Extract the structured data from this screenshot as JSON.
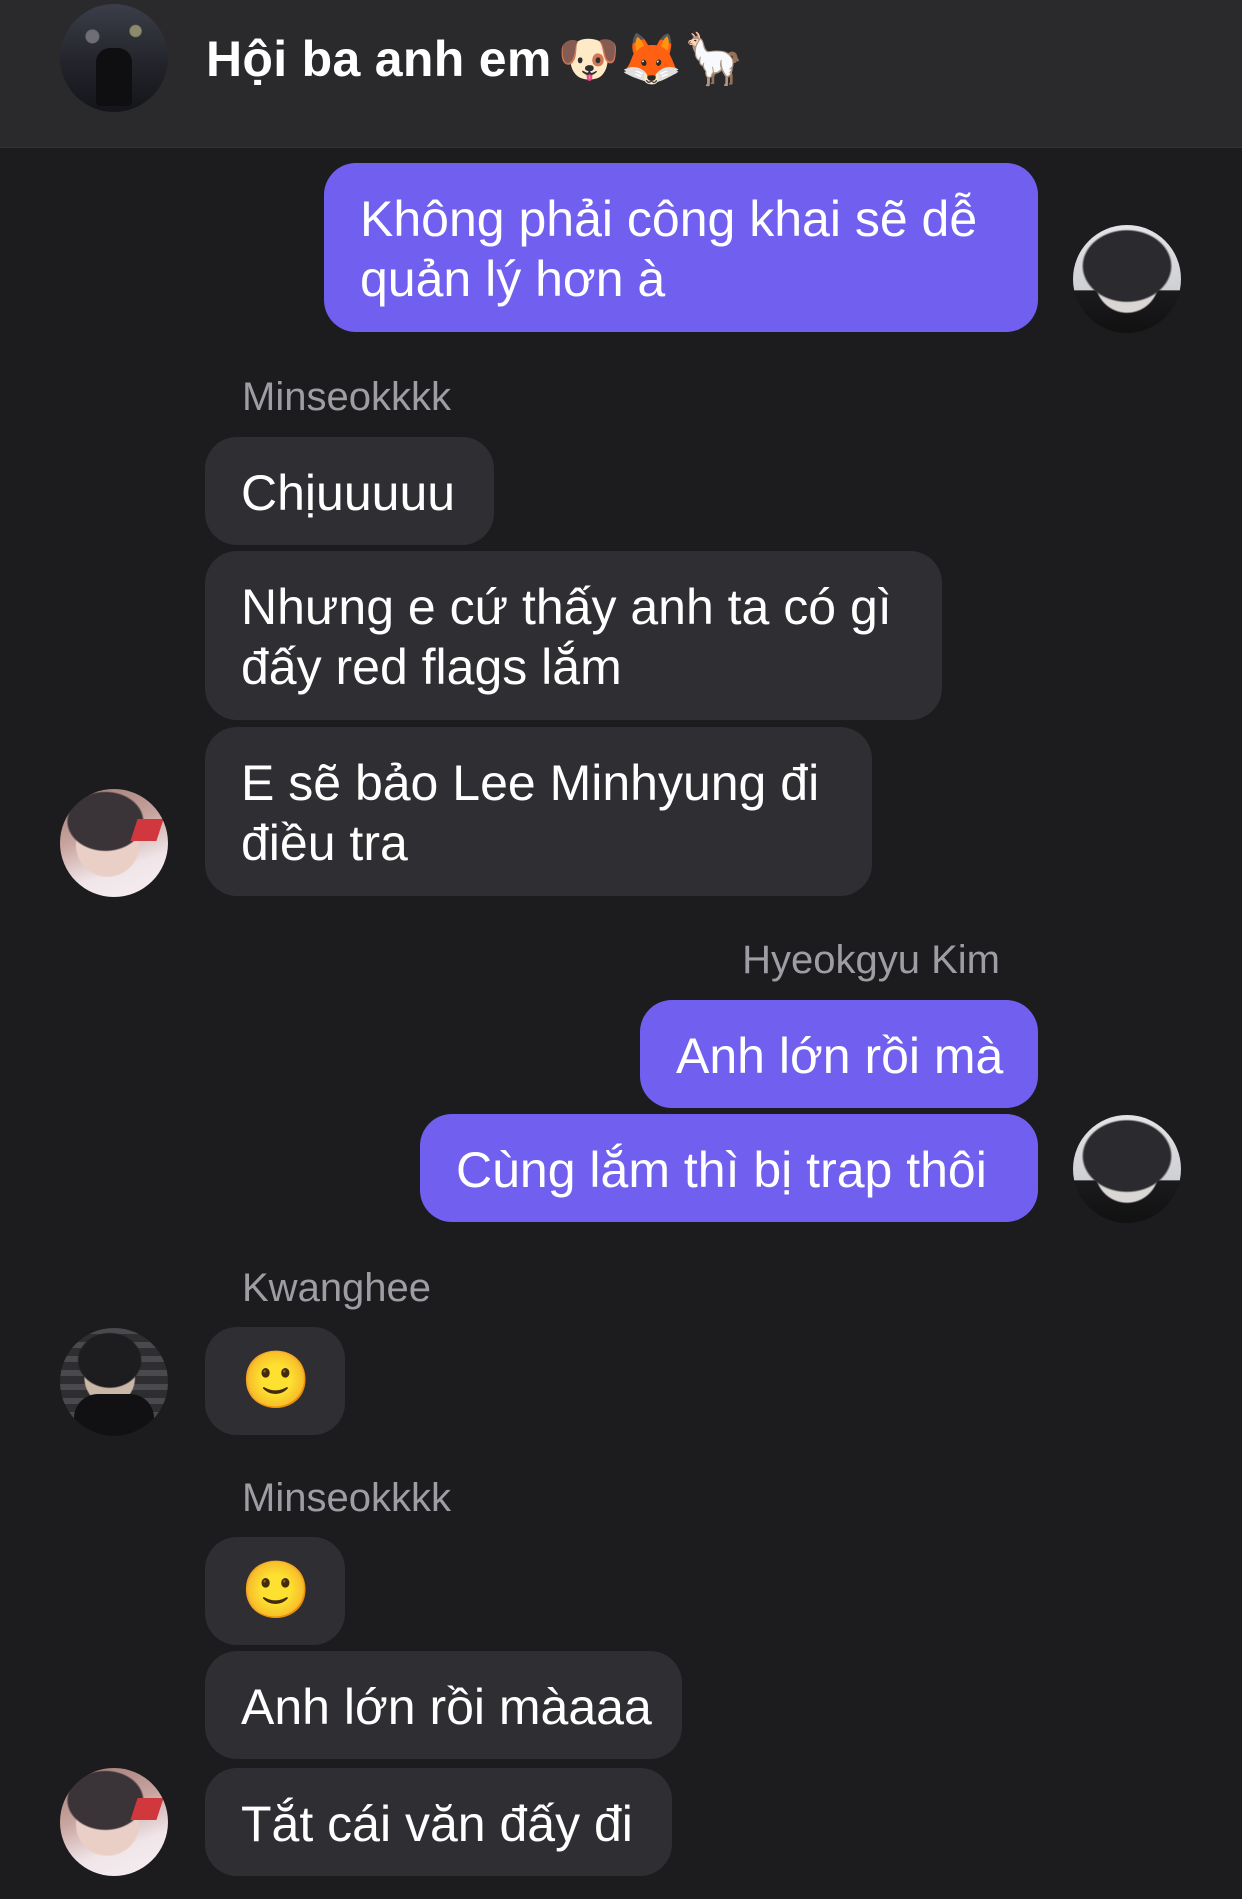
{
  "header": {
    "title": "Hội ba anh em",
    "emojis": "🐶🦊🦙"
  },
  "messages": [
    {
      "sender": "",
      "text_lines": [
        "Không phải công khai sẽ dễ",
        "quản lý hơn à"
      ],
      "direction": "out"
    },
    {
      "sender": "Minseokkkk",
      "text_lines": [
        "Chịuuuuu"
      ],
      "direction": "in"
    },
    {
      "sender": "",
      "text_lines": [
        "Nhưng e cứ thấy anh ta có gì",
        "đấy red flags lắm"
      ],
      "direction": "in"
    },
    {
      "sender": "",
      "text_lines": [
        "E sẽ bảo Lee Minhyung đi",
        "điều tra"
      ],
      "direction": "in"
    },
    {
      "sender": "Hyeokgyu Kim",
      "text_lines": [
        "Anh lớn rồi mà"
      ],
      "direction": "out"
    },
    {
      "sender": "",
      "text_lines": [
        "Cùng lắm thì bị trap thôi"
      ],
      "direction": "out"
    },
    {
      "sender": "Kwanghee",
      "text_lines": [
        "🙂"
      ],
      "direction": "in"
    },
    {
      "sender": "Minseokkkk",
      "text_lines": [
        "🙂"
      ],
      "direction": "in"
    },
    {
      "sender": "",
      "text_lines": [
        "Anh lớn rồi màaaa"
      ],
      "direction": "in"
    },
    {
      "sender": "",
      "text_lines": [
        "Tắt cái văn đấy đi"
      ],
      "direction": "in"
    }
  ],
  "colors": {
    "background": "#1c1c1f",
    "header": "#2a2a2d",
    "outgoing_bubble": "#7160f0",
    "incoming_bubble": "#2f2f33",
    "sender_name": "#9d9da3"
  }
}
